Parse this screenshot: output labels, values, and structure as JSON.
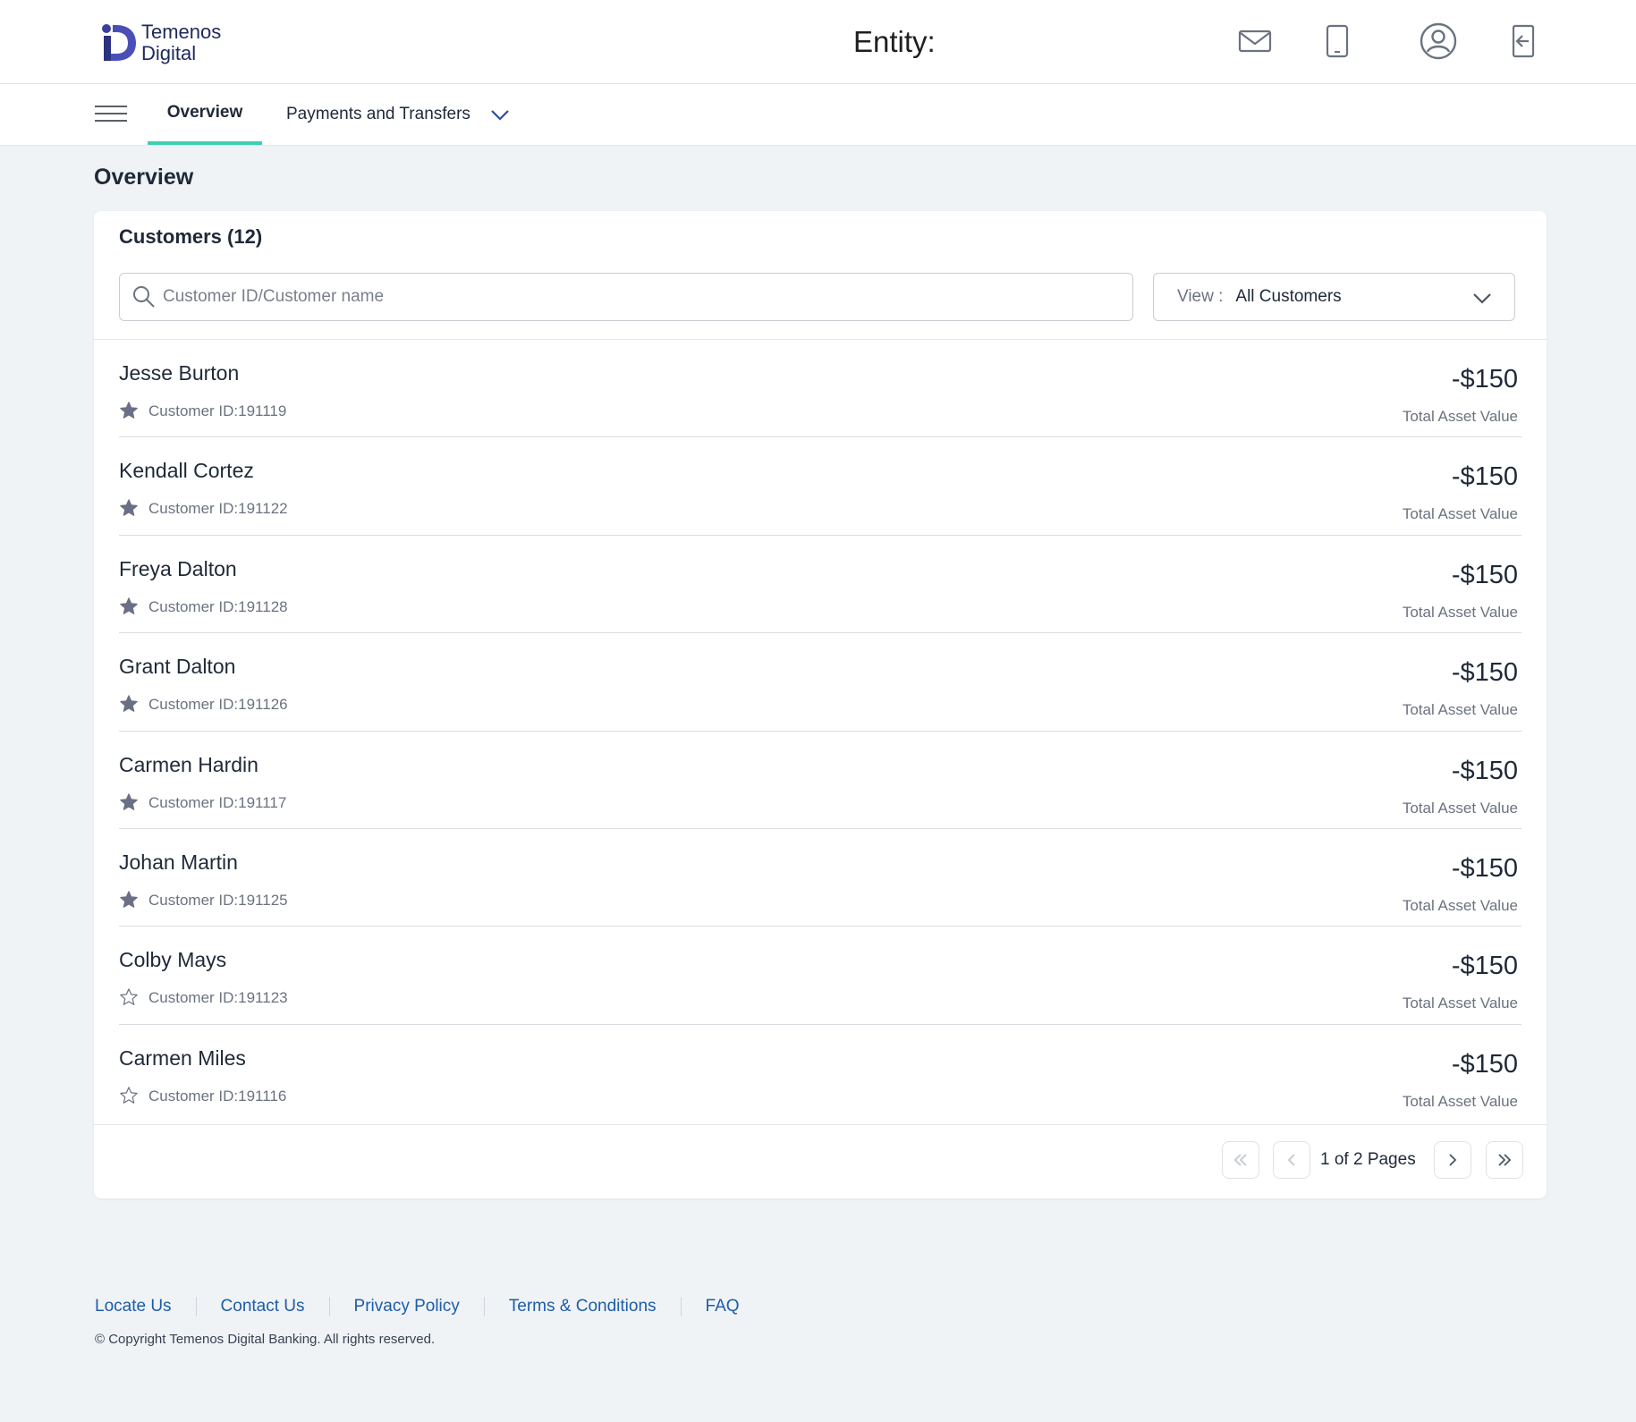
{
  "header": {
    "logo_line1": "Temenos",
    "logo_line2": "Digital",
    "entity_label": "Entity:",
    "icons": [
      "mail-icon",
      "mobile-icon",
      "profile-icon",
      "logout-icon"
    ]
  },
  "nav": {
    "menu_icon": "hamburger-icon",
    "tabs": [
      {
        "label": "Overview",
        "active": true
      },
      {
        "label": "Payments and Transfers",
        "active": false
      }
    ],
    "accent_color": "#3ecfb3"
  },
  "page": {
    "title": "Overview"
  },
  "customers": {
    "title": "Customers (12)",
    "search_placeholder": "Customer ID/Customer name",
    "view_label": "View :",
    "view_value": "All Customers",
    "rows": [
      {
        "name": "Jesse Burton",
        "id": "Customer ID:191119",
        "favorite": true,
        "amount": "-$150",
        "amount_label": "Total Asset Value"
      },
      {
        "name": "Kendall Cortez",
        "id": "Customer ID:191122",
        "favorite": true,
        "amount": "-$150",
        "amount_label": "Total Asset Value"
      },
      {
        "name": "Freya Dalton",
        "id": "Customer ID:191128",
        "favorite": true,
        "amount": "-$150",
        "amount_label": "Total Asset Value"
      },
      {
        "name": "Grant Dalton",
        "id": "Customer ID:191126",
        "favorite": true,
        "amount": "-$150",
        "amount_label": "Total Asset Value"
      },
      {
        "name": "Carmen Hardin",
        "id": "Customer ID:191117",
        "favorite": true,
        "amount": "-$150",
        "amount_label": "Total Asset Value"
      },
      {
        "name": "Johan Martin",
        "id": "Customer ID:191125",
        "favorite": true,
        "amount": "-$150",
        "amount_label": "Total Asset Value"
      },
      {
        "name": "Colby Mays",
        "id": "Customer ID:191123",
        "favorite": false,
        "amount": "-$150",
        "amount_label": "Total Asset Value"
      },
      {
        "name": "Carmen Miles",
        "id": "Customer ID:191116",
        "favorite": false,
        "amount": "-$150",
        "amount_label": "Total Asset Value"
      }
    ],
    "pagination": {
      "text": "1 of 2 Pages"
    }
  },
  "footer": {
    "links": [
      "Locate Us",
      "Contact Us",
      "Privacy Policy",
      "Terms & Conditions",
      "FAQ"
    ],
    "copyright": "© Copyright Temenos Digital Banking. All rights reserved.",
    "link_color": "#1d5ca8"
  }
}
